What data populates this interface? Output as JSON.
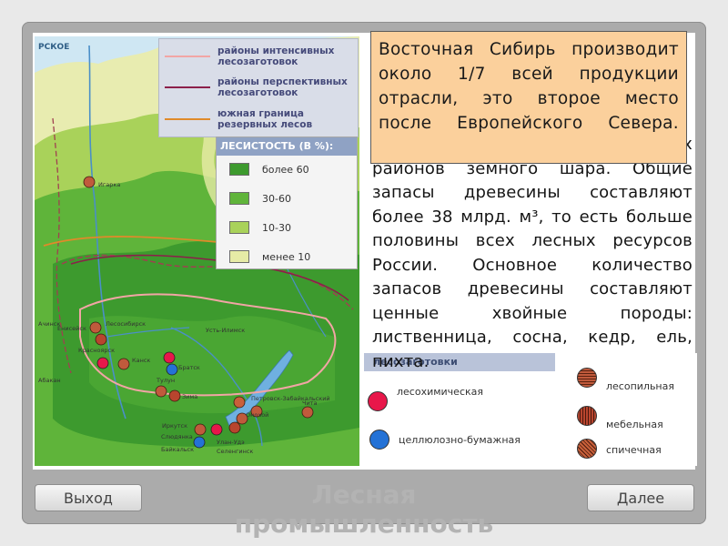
{
  "map": {
    "sea_label": "РСКОЕ",
    "cities": [
      "Игарка",
      "Енисейск",
      "Лесосибирск",
      "Красноярск",
      "Канск",
      "Усть-Илимск",
      "Братск",
      "Тулун",
      "Зима",
      "Иркутск",
      "Слюдянка",
      "Байкальск",
      "Улан-Удэ",
      "Селенгинск",
      "Онохой",
      "Чита",
      "Петровск-Забайкальский",
      "Абакан",
      "Ачинск"
    ]
  },
  "legend_lines": [
    {
      "label": "районы интенсивных лесозаготовок",
      "color": "#f2a5a5"
    },
    {
      "label": "районы перспективных лесозаготовок",
      "color": "#8c1f4a"
    },
    {
      "label": "южная граница резервных лесов",
      "color": "#e08a2a"
    }
  ],
  "legend_fill": {
    "title": "ЛЕСИСТОСТЬ (В %):",
    "items": [
      {
        "label": "более 60",
        "color": "#3d9a2e"
      },
      {
        "label": "30-60",
        "color": "#5fb43a"
      },
      {
        "label": "10-30",
        "color": "#a9d25a"
      },
      {
        "label": "менее 10",
        "color": "#e6eba6"
      }
    ]
  },
  "callout_text": "Восточная Сибирь производит около 1/7 всей продукции отрасли, это второе место после Европейского Севера.",
  "main_text": "Здесь один из величайших лесных районов земного шара. Общие запасы древесины составляют более 38 млрд. м³, то есть больше половины всех лесных ресурсов России. Основное количество запасов древесины составляют ценные хвойные породы: лиственница, сосна, кедр, ель, пихта.",
  "industries": {
    "header": "лесозаготовки",
    "items": [
      {
        "label": "лесохимическая",
        "color": "#e8174a"
      },
      {
        "label": "целлюлозно-бумажная",
        "color": "#2472d6"
      },
      {
        "label": "лесопильная",
        "color": "#c05a3c"
      },
      {
        "label": "мебельная",
        "color": "#b8452e"
      },
      {
        "label": "спичечная",
        "color": "#c8603a"
      }
    ]
  },
  "buttons": {
    "exit": "Выход",
    "next": "Далее"
  },
  "watermark": "Лесная промышленность"
}
